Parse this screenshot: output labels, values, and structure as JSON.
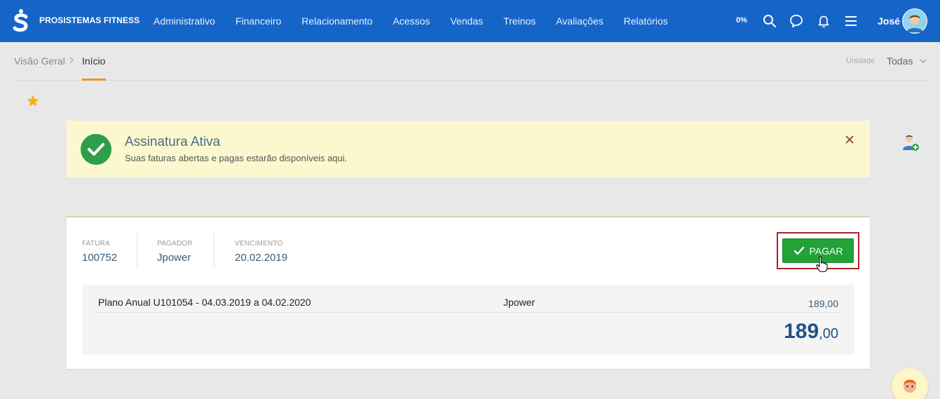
{
  "header": {
    "brand": "PROSISTEMAS FITNESS",
    "nav": [
      "Administrativo",
      "Financeiro",
      "Relacionamento",
      "Acessos",
      "Vendas",
      "Treinos",
      "Avaliações",
      "Relatórios"
    ],
    "progress_label": "0%",
    "icons": [
      "search-icon",
      "chat-icon",
      "bell-icon",
      "menu-icon"
    ],
    "user_name": "José"
  },
  "breadcrumb": {
    "items": [
      "Visão Geral",
      "Início"
    ]
  },
  "unit": {
    "label": "Unidade",
    "value": "Todas"
  },
  "alert": {
    "title": "Assinatura Ativa",
    "subtitle": "Suas faturas abertas e pagas estarão disponíveis aqui."
  },
  "invoice": {
    "fields": [
      {
        "label": "FATURA",
        "value": "100752"
      },
      {
        "label": "PAGADOR",
        "value": "Jpower"
      },
      {
        "label": "VENCIMENTO",
        "value": "20.02.2019"
      }
    ],
    "pay_label": "PAGAR",
    "items": [
      {
        "description": "Plano Anual U101054 - 04.03.2019 a 04.02.2020",
        "payer": "Jpower",
        "amount": "189,00"
      }
    ],
    "total_int": "189",
    "total_dec": ",00"
  },
  "colors": {
    "topbar": "#1565c8",
    "accent": "#f0932b",
    "success": "#22a237",
    "alert_bg": "#fbf8cf"
  }
}
